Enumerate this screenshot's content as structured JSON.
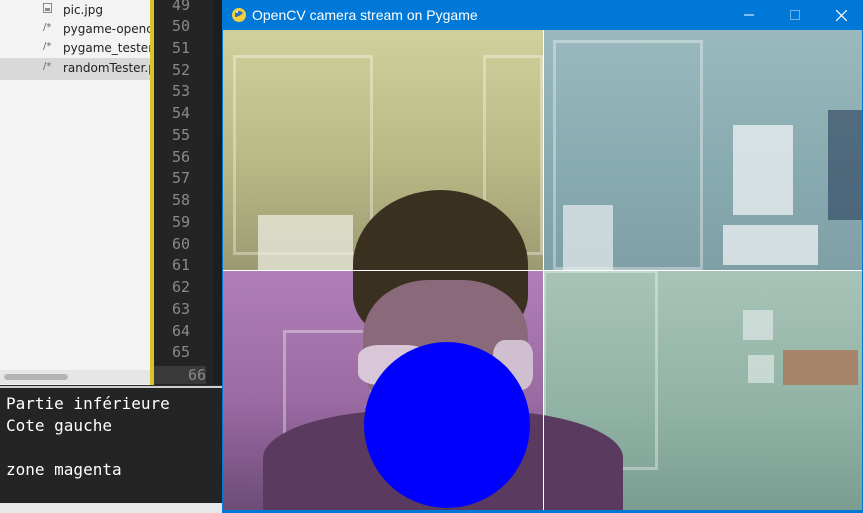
{
  "explorer": {
    "files": [
      {
        "name": "pic.jpg",
        "icon": "image-file-icon"
      },
      {
        "name": "pygame-opencv_",
        "icon": "python-file-icon"
      },
      {
        "name": "pygame_tester.py",
        "icon": "python-file-icon"
      },
      {
        "name": "randomTester.py",
        "icon": "python-file-icon",
        "selected": true
      }
    ]
  },
  "editor": {
    "line_numbers": [
      "49",
      "50",
      "51",
      "52",
      "53",
      "54",
      "55",
      "56",
      "57",
      "58",
      "59",
      "60",
      "61",
      "62",
      "63",
      "64",
      "65",
      "66"
    ],
    "current_line": "66"
  },
  "console": {
    "lines": [
      "Partie inférieure",
      "Cote gauche",
      "",
      "zone magenta"
    ]
  },
  "pygame_window": {
    "title": "OpenCV camera stream on Pygame",
    "minimize_label": "—",
    "maximize_label": "☐",
    "close_label": "✕",
    "overlay": {
      "circle_color": "#0000ff",
      "grid_line_color": "#ffffff",
      "quadrant_tints": {
        "top_left": "yellow",
        "top_right": "cyan",
        "bottom_left": "magenta",
        "bottom_right": "green"
      }
    }
  },
  "colors": {
    "titlebar": "#0078d7",
    "gutter_accent": "#d8c32a",
    "console_bg": "#242424"
  }
}
